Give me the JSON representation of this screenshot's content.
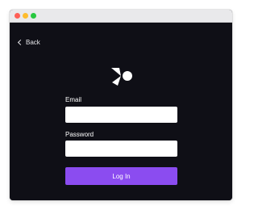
{
  "window": {
    "controls": [
      "close-light",
      "minimize-light",
      "zoom-light"
    ]
  },
  "nav": {
    "back_label": "Back",
    "back_icon": "chevron-left-icon"
  },
  "brand": {
    "logo_icon": "app-logo-icon",
    "accent_color": "#8b4cf0"
  },
  "form": {
    "email_label": "Email",
    "email_value": "",
    "email_placeholder": "",
    "password_label": "Password",
    "password_value": "",
    "password_placeholder": "",
    "submit_label": "Log In"
  }
}
